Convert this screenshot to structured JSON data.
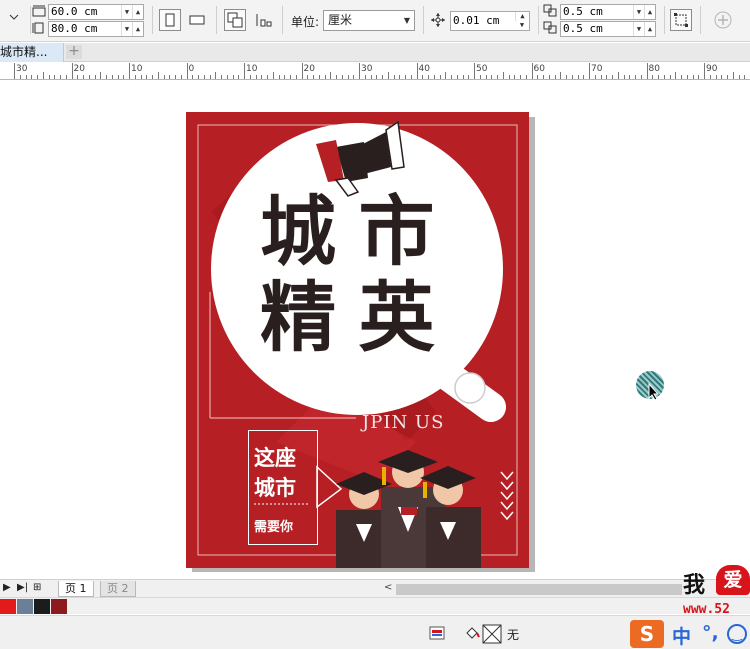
{
  "toolbar": {
    "width_value": "60.0 cm",
    "height_value": "80.0 cm",
    "units_label": "单位:",
    "units_value": "厘米",
    "nudge_value": "0.01 cm",
    "dup_x_value": "0.5 cm",
    "dup_y_value": "0.5 cm"
  },
  "document": {
    "tab_label": "城市精..."
  },
  "ruler": {
    "labels": [
      "30",
      "20",
      "10",
      "0",
      "10",
      "20",
      "30",
      "40",
      "50",
      "60",
      "70",
      "80",
      "90"
    ]
  },
  "poster": {
    "title_line_1": "城 市",
    "title_line_2": "精 英",
    "subtitle": "JPIN US",
    "slogan_line_1": "这座",
    "slogan_line_2": "城市",
    "slogan_line_3": "需要你",
    "background_color": "#b61f24",
    "text_dark_color": "#2a1f1f"
  },
  "pages": {
    "tab_1": "页 1",
    "tab_2": "页 2"
  },
  "palette": {
    "colors": [
      "#e31a1c",
      "#6b7f99",
      "#1c1c1c",
      "#8c1a1f"
    ]
  },
  "status": {
    "fill_label": "无"
  },
  "watermark": {
    "text": "我",
    "heart_text": "爱",
    "url": "www.52"
  },
  "ime": {
    "logo": "S",
    "lang": "中",
    "punct": "°,"
  }
}
